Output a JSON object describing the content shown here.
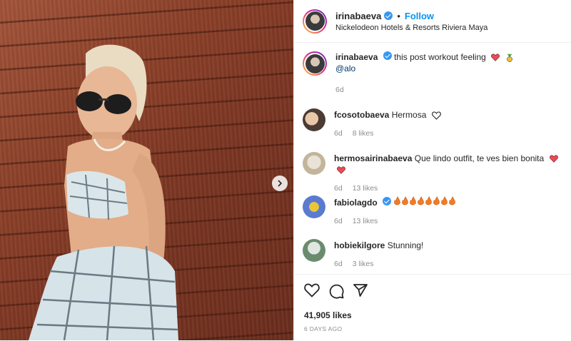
{
  "post": {
    "username": "irinabaeva",
    "follow_label": "Follow",
    "dot": "•",
    "location": "Nickelodeon Hotels & Resorts Riviera Maya"
  },
  "caption": {
    "username": "irinabaeva",
    "text": "this post workout feeling",
    "mention": "@alo",
    "age": "6d"
  },
  "comments": [
    {
      "username": "fcosotobaeva",
      "text": "Hermosa",
      "age": "6d",
      "likes": "8 likes",
      "avatar_colors": [
        "#e7c8a8",
        "#4a3b33"
      ]
    },
    {
      "username": "hermosairinabaeva",
      "text": "Que lindo outfit, te ves bien bonita",
      "age": "6d",
      "likes": "13 likes",
      "avatar_colors": [
        "#e9e2d8",
        "#c2b59b"
      ]
    },
    {
      "username": "fabiolagdo",
      "text": "",
      "age": "6d",
      "likes": "13 likes",
      "avatar_colors": [
        "#e8c53a",
        "#5a7bd0"
      ]
    },
    {
      "username": "hobiekilgore",
      "text": "Stunning!",
      "age": "6d",
      "likes": "3 likes",
      "avatar_colors": [
        "#dfe7e0",
        "#6b8b6f"
      ]
    }
  ],
  "likes_count": "41,905 likes",
  "date": "6 DAYS AGO",
  "colors": {
    "accent": "#0095f6",
    "verified": "#3897f0",
    "heart": "#ed4956",
    "muted": "#8e8e8e"
  }
}
